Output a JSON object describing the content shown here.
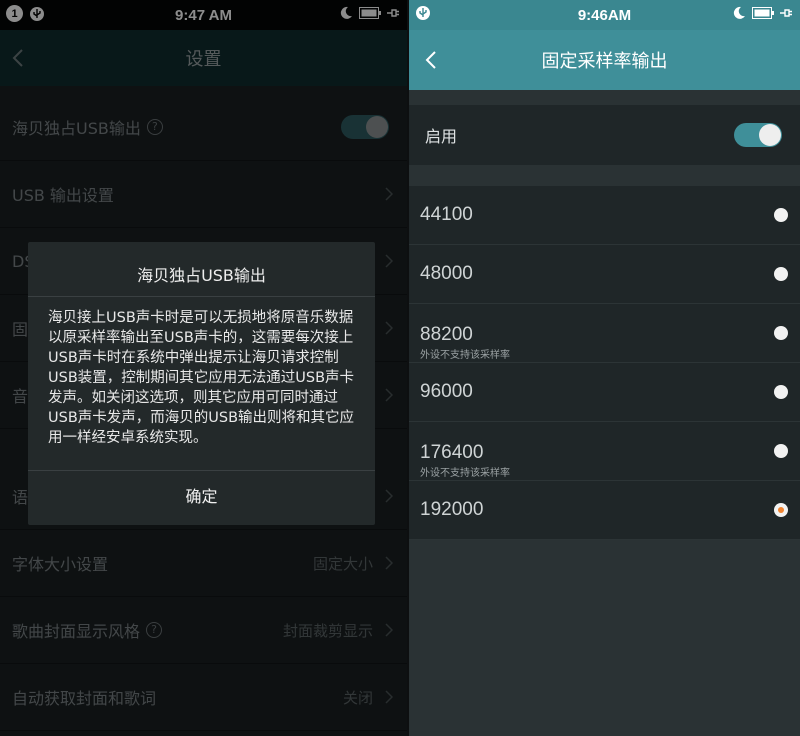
{
  "left": {
    "status": {
      "badge": "1",
      "time": "9:47 AM"
    },
    "title": "设置",
    "rows": [
      {
        "label": "海贝独占USB输出",
        "help": "?",
        "type": "toggle"
      },
      {
        "label": "USB 输出设置"
      },
      {
        "label": "DS"
      },
      {
        "label": "固"
      },
      {
        "label": "音"
      },
      {
        "label": "语言设置"
      },
      {
        "label": "字体大小设置",
        "value": "固定大小"
      },
      {
        "label": "歌曲封面显示风格",
        "help": "?",
        "value": "封面裁剪显示"
      },
      {
        "label": "自动获取封面和歌词",
        "value": "关闭"
      }
    ],
    "dialog": {
      "title": "海贝独占USB输出",
      "body": "海贝接上USB声卡时是可以无损地将原音乐数据以原采样率输出至USB声卡的，这需要每次接上USB声卡时在系统中弹出提示让海贝请求控制USB装置，控制期间其它应用无法通过USB声卡发声。如关闭这选项，则其它应用可同时通过USB声卡发声，而海贝的USB输出则将和其它应用一样经安卓系统实现。",
      "ok": "确定"
    }
  },
  "right": {
    "status": {
      "time": "9:46AM"
    },
    "title": "固定采样率输出",
    "enable_label": "启用",
    "enable_on": true,
    "rates": [
      {
        "value": "44100",
        "note": "",
        "selected": false
      },
      {
        "value": "48000",
        "note": "",
        "selected": false
      },
      {
        "value": "88200",
        "note": "外设不支持该采样率",
        "selected": false
      },
      {
        "value": "96000",
        "note": "",
        "selected": false
      },
      {
        "value": "176400",
        "note": "外设不支持该采样率",
        "selected": false
      },
      {
        "value": "192000",
        "note": "",
        "selected": true
      }
    ]
  },
  "colors": {
    "accent": "#3f8f99",
    "selected_dot": "#f08431"
  }
}
